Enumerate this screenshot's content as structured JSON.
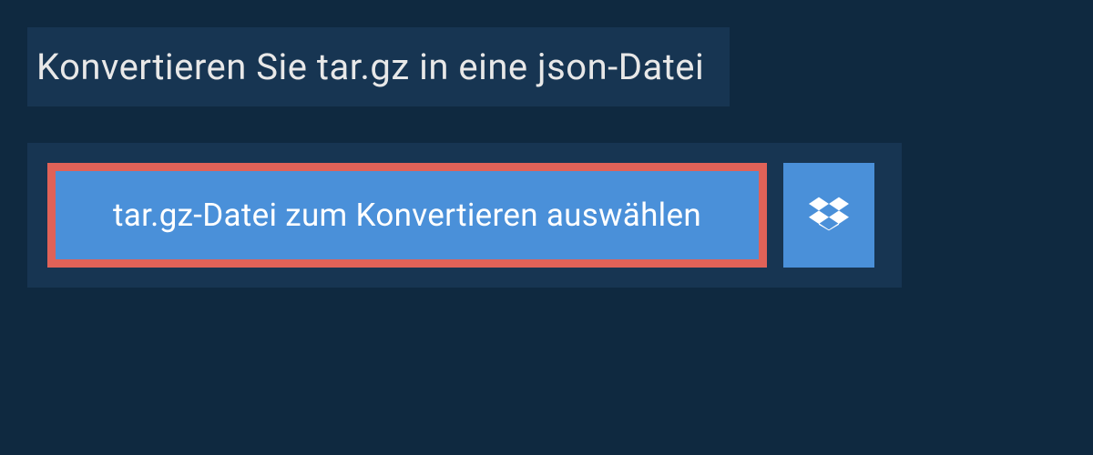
{
  "header": {
    "title": "Konvertieren Sie tar.gz in eine json-Datei"
  },
  "actions": {
    "select_label": "tar.gz-Datei zum Konvertieren auswählen",
    "dropbox_icon": "dropbox"
  },
  "colors": {
    "page_bg": "#0f2940",
    "panel_bg": "#173552",
    "button_bg": "#4a90d9",
    "highlight_border": "#e06258",
    "text_light": "#e8e8e8",
    "text_white": "#ffffff"
  }
}
